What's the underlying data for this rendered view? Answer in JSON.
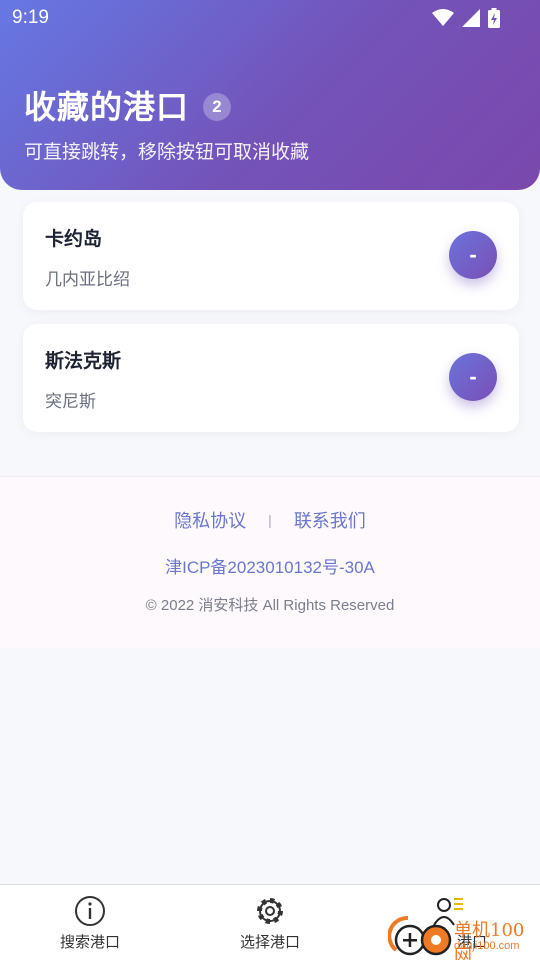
{
  "status_bar": {
    "time": "9:19",
    "icons": [
      "wifi-icon",
      "signal-icon",
      "battery-icon"
    ]
  },
  "header": {
    "title": "收藏的港口",
    "count": "2",
    "subtitle": "可直接跳转，移除按钮可取消收藏"
  },
  "favorites": [
    {
      "name": "卡约岛",
      "country": "几内亚比绍",
      "remove_label": "-"
    },
    {
      "name": "斯法克斯",
      "country": "突尼斯",
      "remove_label": "-"
    }
  ],
  "footer": {
    "privacy": "隐私协议",
    "separator": "|",
    "contact": "联系我们",
    "icp": "津ICP备2023010132号-30A",
    "copyright": "© 2022 消安科技 All Rights Reserved"
  },
  "bottom_nav": [
    {
      "label": "搜索港口",
      "icon": "info-icon"
    },
    {
      "label": "选择港口",
      "icon": "gear-icon"
    },
    {
      "label": "港口",
      "icon": "user-list-icon"
    }
  ],
  "watermark": {
    "text": "单机100网",
    "url_text": "danji100.com"
  },
  "colors": {
    "accent_start": "#6678e4",
    "accent_end": "#7a48ad",
    "link": "#6a77cf"
  }
}
